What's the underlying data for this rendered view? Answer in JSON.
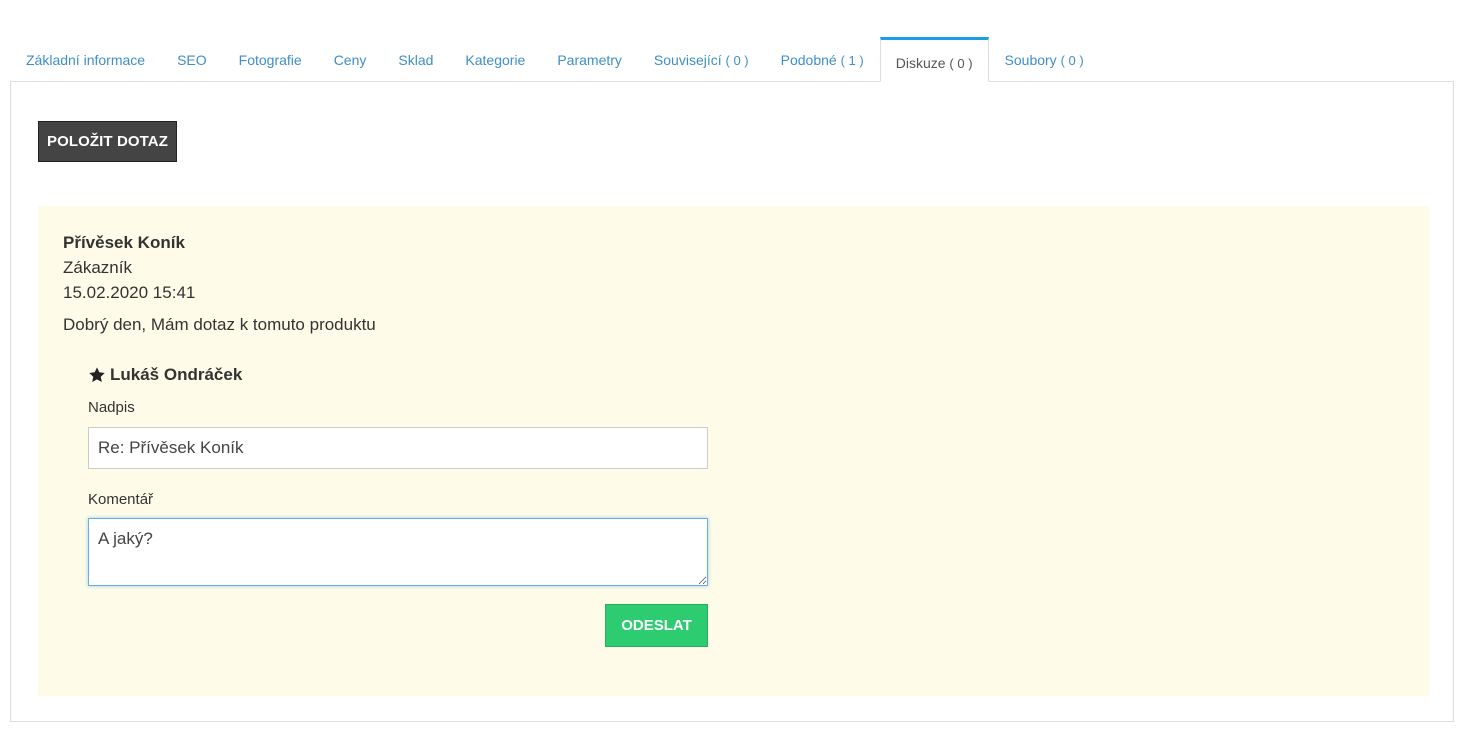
{
  "tabs": [
    {
      "label": "Základní informace",
      "count": ""
    },
    {
      "label": "SEO",
      "count": ""
    },
    {
      "label": "Fotografie",
      "count": ""
    },
    {
      "label": "Ceny",
      "count": ""
    },
    {
      "label": "Sklad",
      "count": ""
    },
    {
      "label": "Kategorie",
      "count": ""
    },
    {
      "label": "Parametry",
      "count": ""
    },
    {
      "label": "Související",
      "count": "( 0 )"
    },
    {
      "label": "Podobné",
      "count": "( 1 )"
    },
    {
      "label": "Diskuze",
      "count": "( 0 )"
    },
    {
      "label": "Soubory",
      "count": "( 0 )"
    }
  ],
  "active_tab": "Diskuze",
  "ask_button_label": "POLOŽIT DOTAZ",
  "discussion": {
    "title": "Přívěsek Koník",
    "role": "Zákazník",
    "date": "15.02.2020 15:41",
    "text": "Dobrý den, Mám dotaz k tomuto produktu"
  },
  "reply": {
    "author": "Lukáš Ondráček",
    "author_icon": "star-icon",
    "title_label": "Nadpis",
    "title_value": "Re: Přívěsek Koník",
    "comment_label": "Komentář",
    "comment_value": "A jaký?",
    "send_label": "ODESLAT"
  },
  "colors": {
    "accent": "#1b9ee4",
    "link": "#3f8fc8",
    "discussion_bg": "#fefce8",
    "send_button": "#2ecc71",
    "ask_button": "#444444"
  }
}
